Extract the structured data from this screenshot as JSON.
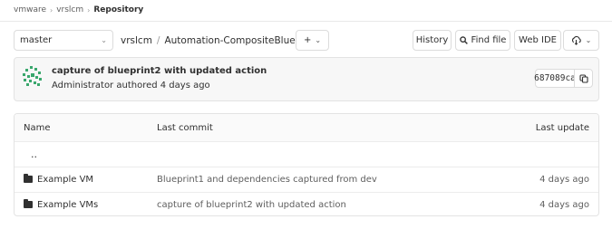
{
  "breadcrumb": [
    "vmware",
    "vrslcm",
    "Repository"
  ],
  "toolbar": {
    "branch": "master",
    "path_root": "vrslcm",
    "path_folder": "Automation-CompositeBlueprint",
    "path_sep": "/",
    "plus_label": "+",
    "history_label": "History",
    "find_file_label": "Find file",
    "web_ide_label": "Web IDE"
  },
  "commit": {
    "title": "capture of blueprint2 with updated action",
    "meta": "Administrator authored 4 days ago",
    "sha": "687089ca"
  },
  "table": {
    "headers": {
      "name": "Name",
      "last_commit": "Last commit",
      "last_update": "Last update"
    },
    "parent_label": "..",
    "rows": [
      {
        "name": "Example VM",
        "commit": "Blueprint1 and dependencies captured from dev",
        "updated": "4 days ago"
      },
      {
        "name": "Example VMs",
        "commit": "capture of blueprint2 with updated action",
        "updated": "4 days ago"
      }
    ]
  },
  "colors": {
    "folder": "#303030",
    "border": "#dcdcdc",
    "commit_bg": "#f7f7f7",
    "avatar": "#3aa76d"
  }
}
